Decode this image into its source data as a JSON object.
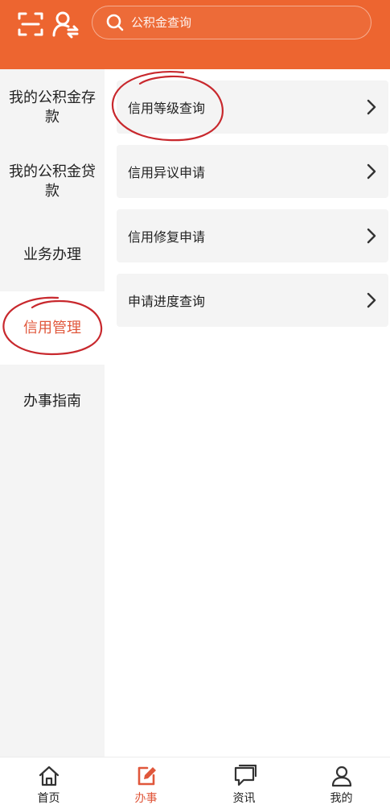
{
  "header": {
    "search_placeholder": "公积金查询",
    "icons": [
      "scan-icon",
      "user-switch-icon",
      "search-icon"
    ]
  },
  "sidebar": {
    "items": [
      {
        "label": "我的公积金存款"
      },
      {
        "label": "我的公积金贷款"
      },
      {
        "label": "业务办理"
      },
      {
        "label": "信用管理"
      },
      {
        "label": "办事指南"
      }
    ],
    "active_index": 3
  },
  "menu": {
    "items": [
      {
        "label": "信用等级查询"
      },
      {
        "label": "信用异议申请"
      },
      {
        "label": "信用修复申请"
      },
      {
        "label": "申请进度查询"
      }
    ]
  },
  "bottom_nav": {
    "tabs": [
      {
        "label": "首页",
        "icon": "home-icon"
      },
      {
        "label": "办事",
        "icon": "edit-icon"
      },
      {
        "label": "资讯",
        "icon": "chat-icon"
      },
      {
        "label": "我的",
        "icon": "person-icon"
      }
    ],
    "active_index": 1
  },
  "colors": {
    "brand": "#ed6530",
    "active_text": "#e0573b",
    "sidebar_bg": "#f4f4f4"
  }
}
